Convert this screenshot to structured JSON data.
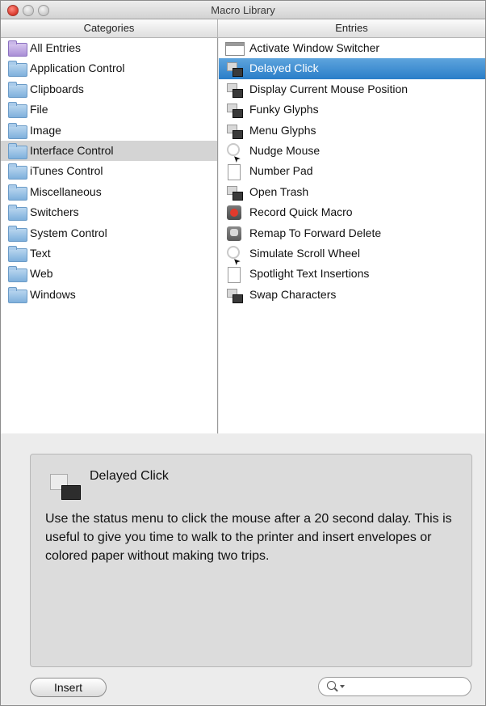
{
  "window": {
    "title": "Macro Library"
  },
  "columns": {
    "categories": "Categories",
    "entries": "Entries"
  },
  "categories": [
    {
      "label": "All Entries",
      "icon": "smart-folder-icon"
    },
    {
      "label": "Application Control",
      "icon": "folder-icon"
    },
    {
      "label": "Clipboards",
      "icon": "folder-icon"
    },
    {
      "label": "File",
      "icon": "folder-icon"
    },
    {
      "label": "Image",
      "icon": "folder-icon"
    },
    {
      "label": "Interface Control",
      "icon": "folder-icon",
      "selected": true
    },
    {
      "label": "iTunes Control",
      "icon": "folder-icon"
    },
    {
      "label": "Miscellaneous",
      "icon": "folder-icon"
    },
    {
      "label": "Switchers",
      "icon": "folder-icon"
    },
    {
      "label": "System Control",
      "icon": "folder-icon"
    },
    {
      "label": "Text",
      "icon": "folder-icon"
    },
    {
      "label": "Web",
      "icon": "folder-icon"
    },
    {
      "label": "Windows",
      "icon": "folder-icon"
    }
  ],
  "entries": [
    {
      "label": "Activate Window Switcher",
      "icon": "window-icon"
    },
    {
      "label": "Delayed Click",
      "icon": "stacked-windows-icon",
      "selected": true
    },
    {
      "label": "Display Current Mouse Position",
      "icon": "stacked-windows-icon"
    },
    {
      "label": "Funky Glyphs",
      "icon": "stacked-windows-icon"
    },
    {
      "label": "Menu Glyphs",
      "icon": "stacked-windows-icon"
    },
    {
      "label": "Nudge Mouse",
      "icon": "mouse-target-icon"
    },
    {
      "label": "Number Pad",
      "icon": "document-icon"
    },
    {
      "label": "Open Trash",
      "icon": "stacked-windows-icon"
    },
    {
      "label": "Record Quick Macro",
      "icon": "record-icon"
    },
    {
      "label": "Remap To Forward Delete",
      "icon": "remap-key-icon"
    },
    {
      "label": "Simulate Scroll Wheel",
      "icon": "mouse-target-icon"
    },
    {
      "label": "Spotlight Text Insertions",
      "icon": "document-icon"
    },
    {
      "label": "Swap Characters",
      "icon": "stacked-windows-icon"
    }
  ],
  "detail": {
    "title": "Delayed Click",
    "description": "Use the status menu to click the mouse after a 20 second dalay. This is useful to give you time to walk to the printer and insert envelopes or colored paper without making two trips."
  },
  "footer": {
    "insert_label": "Insert",
    "search_placeholder": ""
  },
  "colors": {
    "selection_blue": "#2a7ec8",
    "selection_gray": "#d4d4d4",
    "close_button": "#d8372b"
  }
}
